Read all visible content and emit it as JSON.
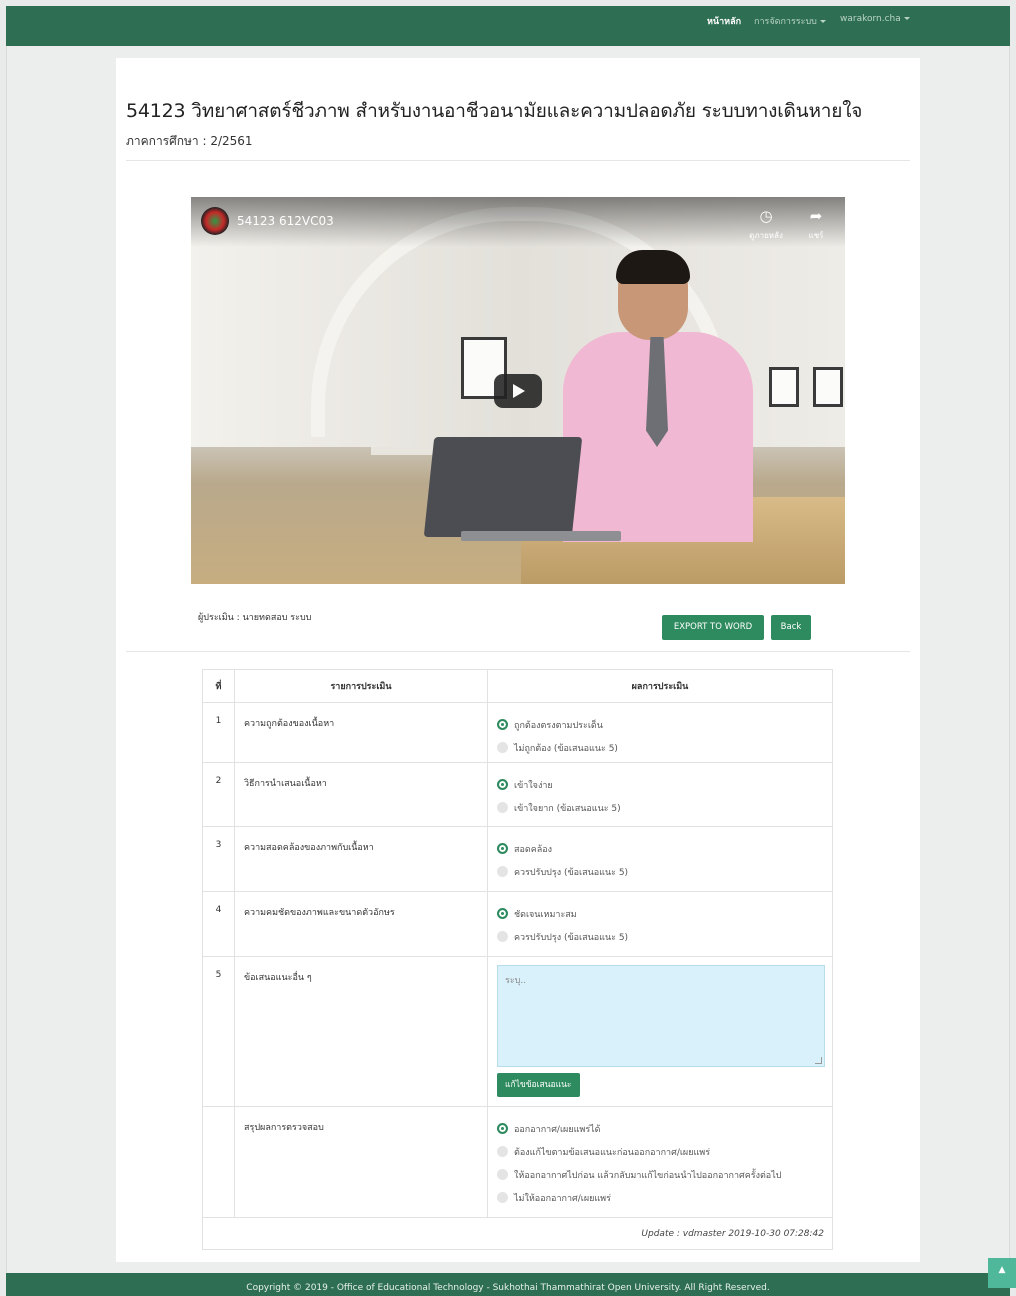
{
  "nav": {
    "home": "หน้าหลัก",
    "manage": "การจัดการระบบ",
    "user": "warakorn.cha"
  },
  "course": {
    "title": "54123 วิทยาศาสตร์ชีวภาพ สำหรับงานอาชีวอนามัยและความปลอดภัย ระบบทางเดินหายใจ",
    "semester": "ภาคการศึกษา : 2/2561"
  },
  "video": {
    "title": "54123 612VC03",
    "watch_later": "ดูภายหลัง",
    "share": "แชร์"
  },
  "evaluator": "ผู้ประเมิน : นายทดสอบ ระบบ",
  "buttons": {
    "export": "EXPORT TO WORD",
    "back": "Back",
    "edit_suggestion": "แก้ไขข้อเสนอแนะ"
  },
  "table": {
    "headers": [
      "ที่",
      "รายการประเมิน",
      "ผลการประเมิน"
    ],
    "rows": [
      {
        "no": "1",
        "item": "ความถูกต้องของเนื้อหา",
        "options": [
          "ถูกต้องตรงตามประเด็น",
          "ไม่ถูกต้อง (ข้อเสนอแนะ 5)"
        ]
      },
      {
        "no": "2",
        "item": "วิธีการนำเสนอเนื้อหา",
        "options": [
          "เข้าใจง่าย",
          "เข้าใจยาก (ข้อเสนอแนะ 5)"
        ]
      },
      {
        "no": "3",
        "item": "ความสอดคล้องของภาพกับเนื้อหา",
        "options": [
          "สอดคล้อง",
          "ควรปรับปรุง (ข้อเสนอแนะ 5)"
        ]
      },
      {
        "no": "4",
        "item": "ความคมชัดของภาพและขนาดตัวอักษร",
        "options": [
          "ชัดเจนเหมาะสม",
          "ควรปรับปรุง (ข้อเสนอแนะ 5)"
        ]
      },
      {
        "no": "5",
        "item": "ข้อเสนอแนะอื่น ๆ",
        "placeholder": "ระบุ.."
      }
    ],
    "summary": {
      "item": "สรุปผลการตรวจสอบ",
      "options": [
        "ออกอากาศ/เผยแพร่ได้",
        "ต้องแก้ไขตามข้อเสนอแนะก่อนออกอากาศ/เผยแพร่",
        "ให้ออกอากาศไปก่อน แล้วกลับมาแก้ไขก่อนนำไปออกอากาศครั้งต่อไป",
        "ไม่ให้ออกอากาศ/เผยแพร่"
      ]
    },
    "update": "Update : vdmaster 2019-10-30 07:28:42"
  },
  "footer": "Copyright © 2019 - Office of Educational Technology - Sukhothai Thammathirat Open University. All Right Reserved.",
  "colors": {
    "primary": "#2e6e53",
    "button": "#2e8b5f",
    "textarea": "#d9f1fb"
  }
}
